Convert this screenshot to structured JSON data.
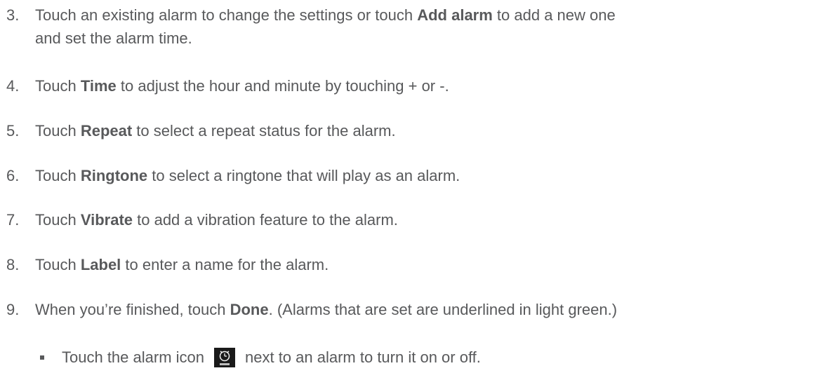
{
  "steps": [
    {
      "number": "3.",
      "before": "Touch an existing alarm to change the settings or touch ",
      "bold": "Add alarm",
      "after": " to add a new one",
      "line2": "and set the alarm time."
    },
    {
      "number": "4.",
      "before": "Touch ",
      "bold": "Time",
      "after": " to adjust the hour and minute by touching + or -."
    },
    {
      "number": "5.",
      "before": "Touch ",
      "bold": "Repeat",
      "after": " to select a repeat status for the alarm."
    },
    {
      "number": "6.",
      "before": "Touch ",
      "bold": "Ringtone",
      "after": " to select a ringtone that will play as an alarm."
    },
    {
      "number": "7.",
      "before": "Touch ",
      "bold": "Vibrate",
      "after": " to add a vibration feature to the alarm."
    },
    {
      "number": "8.",
      "before": "Touch ",
      "bold": "Label",
      "after": " to enter a name for the alarm."
    },
    {
      "number": "9.",
      "before": "When you’re finished, touch ",
      "bold": "Done",
      "after": ". (Alarms that are set are underlined in light green.)"
    }
  ],
  "bullet": {
    "before": "Touch the alarm icon",
    "icon": "alarm-clock-icon",
    "after": "next to an alarm to turn it on or off."
  }
}
